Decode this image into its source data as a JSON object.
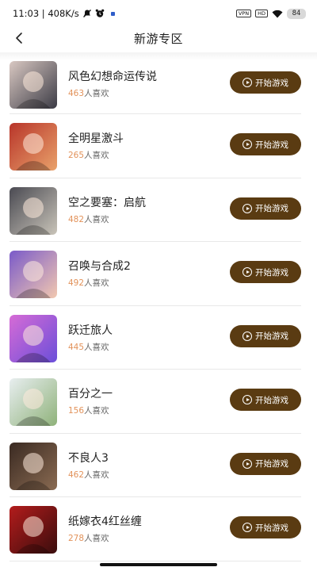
{
  "status_bar": {
    "time_speed": "11:03 | 408K/s",
    "icons": [
      "muted-notification-icon",
      "alarm-icon",
      "app-notification-icon"
    ],
    "right_chips": [
      "VPN",
      "HD"
    ],
    "battery": "84"
  },
  "nav": {
    "back_icon": "chevron-left-icon",
    "title": "新游专区"
  },
  "games": [
    {
      "name": "风色幻想命运传说",
      "likes": "463",
      "likes_suffix": "人喜欢",
      "button": "开始游戏",
      "thumb_colors": [
        "#d9c8c2",
        "#3b3b45"
      ]
    },
    {
      "name": "全明星激斗",
      "likes": "265",
      "likes_suffix": "人喜欢",
      "button": "开始游戏",
      "thumb_colors": [
        "#b8352a",
        "#e9a26b"
      ]
    },
    {
      "name": "空之要塞：启航",
      "likes": "482",
      "likes_suffix": "人喜欢",
      "button": "开始游戏",
      "thumb_colors": [
        "#4a4a52",
        "#c9c4b9"
      ]
    },
    {
      "name": "召唤与合成2",
      "likes": "492",
      "likes_suffix": "人喜欢",
      "button": "开始游戏",
      "thumb_colors": [
        "#7a5ac9",
        "#f2c8b0"
      ]
    },
    {
      "name": "跃迁旅人",
      "likes": "445",
      "likes_suffix": "人喜欢",
      "button": "开始游戏",
      "thumb_colors": [
        "#d66bd6",
        "#6b4fd9"
      ]
    },
    {
      "name": "百分之一",
      "likes": "156",
      "likes_suffix": "人喜欢",
      "button": "开始游戏",
      "thumb_colors": [
        "#e8eef0",
        "#8fb27a"
      ]
    },
    {
      "name": "不良人3",
      "likes": "462",
      "likes_suffix": "人喜欢",
      "button": "开始游戏",
      "thumb_colors": [
        "#3a2a22",
        "#8a6b52"
      ]
    },
    {
      "name": "纸嫁衣4红丝缠",
      "likes": "278",
      "likes_suffix": "人喜欢",
      "button": "开始游戏",
      "thumb_colors": [
        "#b31c1c",
        "#3a0d0d"
      ]
    }
  ],
  "colors": {
    "button_bg": "#5a3b12",
    "likes_number": "#e2925a",
    "divider": "#e8e8e8"
  }
}
